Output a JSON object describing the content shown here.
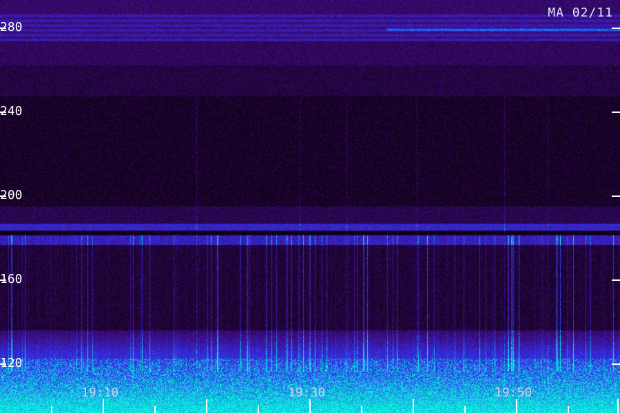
{
  "station_label": "MA 02/11",
  "y_ticks": [
    {
      "value": "280"
    },
    {
      "value": "240"
    },
    {
      "value": "200"
    },
    {
      "value": "160"
    },
    {
      "value": "120"
    }
  ],
  "x_labels": [
    {
      "value": "19:10"
    },
    {
      "value": "19:30"
    },
    {
      "value": "19:50"
    }
  ],
  "colors": {
    "background": "#000000",
    "low_intensity": "#2a0a60",
    "mid_intensity": "#3a20c8",
    "high_intensity": "#20e0e0"
  }
}
